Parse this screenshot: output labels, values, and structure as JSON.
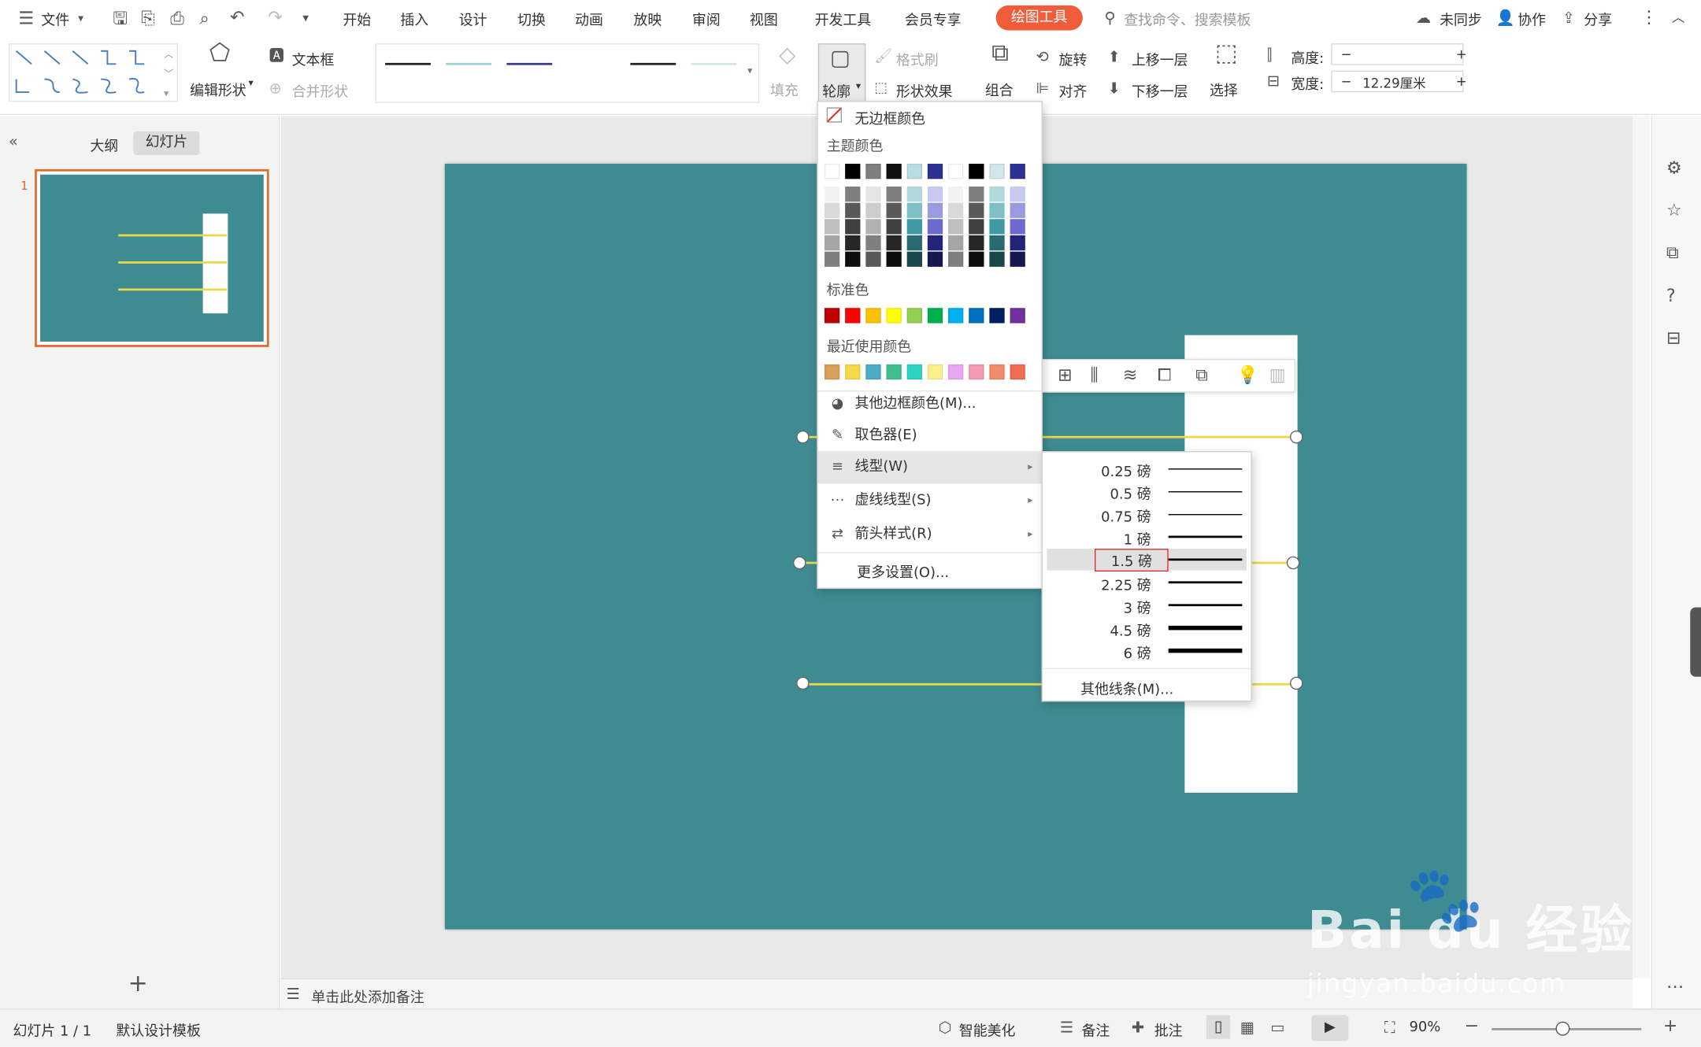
{
  "menubar": {
    "file": "文件",
    "tabs": [
      "开始",
      "插入",
      "设计",
      "切换",
      "动画",
      "放映",
      "审阅",
      "视图",
      "开发工具",
      "会员专享"
    ],
    "active_tool_tab": "绘图工具",
    "search_placeholder": "查找命令、搜索模板",
    "sync": "未同步",
    "collab": "协作",
    "share": "分享"
  },
  "ribbon": {
    "edit_shape": "编辑形状",
    "textbox": "文本框",
    "merge_shape": "合并形状",
    "fill": "填充",
    "outline": "轮廓",
    "format_brush": "格式刷",
    "shape_effect": "形状效果",
    "group": "组合",
    "rotate": "旋转",
    "align": "对齐",
    "bring_forward": "上移一层",
    "send_backward": "下移一层",
    "select": "选择",
    "height_label": "高度:",
    "width_label": "宽度:",
    "height_value": "",
    "width_value": "12.29厘米",
    "minus": "−",
    "plus": "+"
  },
  "left_panel": {
    "tab_outline": "大纲",
    "tab_slides": "幻灯片",
    "slide_number": "1",
    "add_icon": "plus-icon"
  },
  "outline_menu": {
    "no_border": "无边框颜色",
    "theme_colors_title": "主题颜色",
    "theme_top_row": [
      "#ffffff",
      "#000000",
      "#7f7f7f",
      "#111111",
      "#b8dde1",
      "#2e3192",
      "#ffffff",
      "#000000",
      "#d3e7e9",
      "#2e3192"
    ],
    "theme_shades": [
      [
        "#f2f2f2",
        "#7f7f7f",
        "#e5e5e5",
        "#7f7f7f",
        "#b2d8dc",
        "#c9c9ef",
        "#f2f2f2",
        "#7f7f7f",
        "#b2d8dc",
        "#c9c9ef"
      ],
      [
        "#d9d9d9",
        "#595959",
        "#cccccc",
        "#595959",
        "#7dc1c7",
        "#9a9ae0",
        "#d9d9d9",
        "#595959",
        "#7dc1c7",
        "#9a9ae0"
      ],
      [
        "#bfbfbf",
        "#3f3f3f",
        "#b2b2b2",
        "#3f3f3f",
        "#3f9aa2",
        "#6b6bd0",
        "#bfbfbf",
        "#3f3f3f",
        "#3f9aa2",
        "#6b6bd0"
      ],
      [
        "#a5a5a5",
        "#262626",
        "#7f7f7f",
        "#262626",
        "#2a6b71",
        "#23237a",
        "#a5a5a5",
        "#262626",
        "#2a6b71",
        "#23237a"
      ],
      [
        "#7f7f7f",
        "#0d0d0d",
        "#595959",
        "#0d0d0d",
        "#1b474b",
        "#171750",
        "#7f7f7f",
        "#0d0d0d",
        "#1b474b",
        "#171750"
      ]
    ],
    "standard_title": "标准色",
    "standard_colors": [
      "#c00000",
      "#ff0000",
      "#ffc000",
      "#ffff00",
      "#92d050",
      "#00b050",
      "#00b0f0",
      "#0070c0",
      "#002060",
      "#7030a0"
    ],
    "recent_title": "最近使用颜色",
    "recent_colors": [
      "#d9a05b",
      "#f5d94a",
      "#4bacc6",
      "#3fbf8f",
      "#2dd4c4",
      "#f7f28c",
      "#e7a7f2",
      "#f59ab0",
      "#f28a6c",
      "#f26d4f"
    ],
    "more_colors": "其他边框颜色(M)...",
    "eyedropper": "取色器(E)",
    "line_type": "线型(W)",
    "dash_type": "虚线线型(S)",
    "arrow_style": "箭头样式(R)",
    "more_settings": "更多设置(O)..."
  },
  "line_submenu": {
    "weights": [
      "0.25 磅",
      "0.5 磅",
      "0.75 磅",
      "1 磅",
      "1.5 磅",
      "2.25 磅",
      "3 磅",
      "4.5 磅",
      "6 磅"
    ],
    "selected": "1.5 磅",
    "more_lines": "其他线条(M)..."
  },
  "notes": {
    "placeholder": "单击此处添加备注"
  },
  "status": {
    "slide_info": "幻灯片 1 / 1",
    "template": "默认设计模板",
    "beautify": "智能美化",
    "notes": "备注",
    "comments": "批注",
    "zoom": "90%"
  },
  "watermark": {
    "logo": "Bai du 经验",
    "url": "jingyan.baidu.com"
  },
  "colors": {
    "slide_bg": "#3e8b91",
    "accent": "#f05d3a",
    "line_yellow": "#e8d84a",
    "highlight_red": "#e0302e"
  }
}
